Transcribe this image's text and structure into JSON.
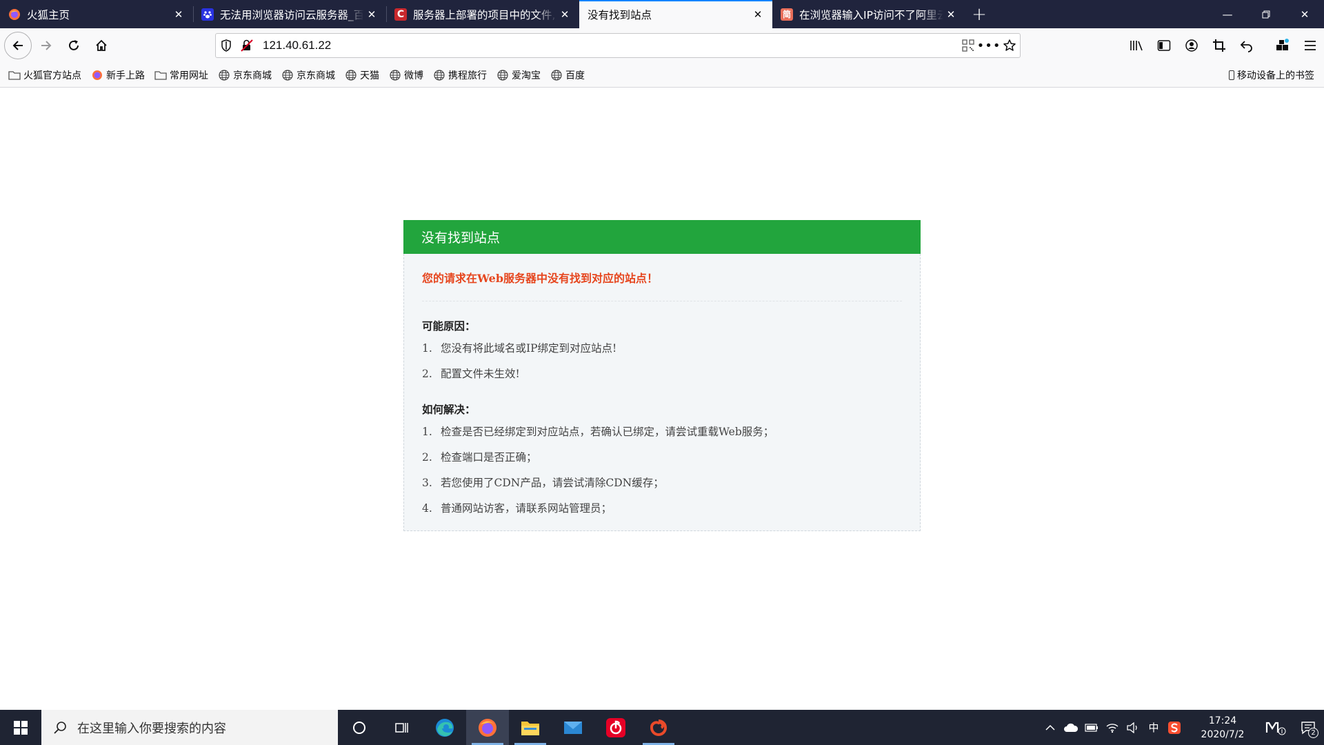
{
  "tabs": [
    {
      "title": "火狐主页",
      "favicon": "firefox-icon",
      "active": false
    },
    {
      "title": "无法用浏览器访问云服务器_百度",
      "favicon": "baidu-paw-icon",
      "active": false
    },
    {
      "title": "服务器上部署的项目中的文件,",
      "favicon": "csdn-c-icon",
      "active": false
    },
    {
      "title": "没有找到站点",
      "favicon": "",
      "active": true
    },
    {
      "title": "在浏览器输入IP访问不了阿里云",
      "favicon": "jianshu-icon",
      "active": false
    }
  ],
  "tab_favicon_glyphs": {
    "csdn": "C",
    "jianshu": "简"
  },
  "url": "121.40.61.22",
  "bookmarks": [
    {
      "label": "火狐官方站点",
      "icon": "folder-icon"
    },
    {
      "label": "新手上路",
      "icon": "firefox-icon"
    },
    {
      "label": "常用网址",
      "icon": "folder-icon"
    },
    {
      "label": "京东商城",
      "icon": "globe-icon"
    },
    {
      "label": "京东商城",
      "icon": "globe-icon"
    },
    {
      "label": "天猫",
      "icon": "globe-icon"
    },
    {
      "label": "微博",
      "icon": "globe-icon"
    },
    {
      "label": "携程旅行",
      "icon": "globe-icon"
    },
    {
      "label": "爱淘宝",
      "icon": "globe-icon"
    },
    {
      "label": "百度",
      "icon": "globe-icon"
    }
  ],
  "mobile_bookmarks": "移动设备上的书签",
  "page": {
    "header": "没有找到站点",
    "error": "您的请求在Web服务器中没有找到对应的站点！",
    "reasons_title": "可能原因：",
    "reasons": [
      {
        "num": "1.",
        "text": "您没有将此域名或IP绑定到对应站点!"
      },
      {
        "num": "2.",
        "text": "配置文件未生效!"
      }
    ],
    "solutions_title": "如何解决：",
    "solutions": [
      {
        "num": "1.",
        "text": "检查是否已经绑定到对应站点，若确认已绑定，请尝试重载Web服务；"
      },
      {
        "num": "2.",
        "text": "检查端口是否正确；"
      },
      {
        "num": "3.",
        "text": "若您使用了CDN产品，请尝试清除CDN缓存；"
      },
      {
        "num": "4.",
        "text": "普通网站访客，请联系网站管理员；"
      }
    ]
  },
  "taskbar": {
    "search_placeholder": "在这里输入你要搜索的内容",
    "ime": "中",
    "time": "17:24",
    "date": "2020/7/2",
    "notification_count": "2"
  },
  "colors": {
    "header_green": "#22a53d",
    "error_red": "#e6461e",
    "tabbar_bg": "#20243d",
    "active_tab_accent": "#0a84ff"
  }
}
